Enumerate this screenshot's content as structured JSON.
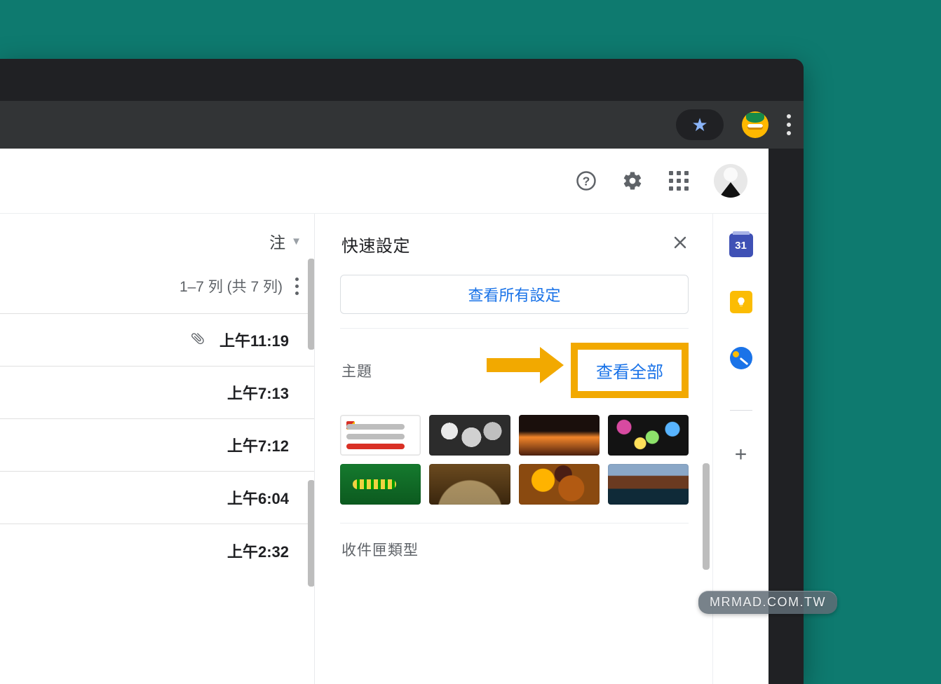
{
  "browser": {
    "star_tooltip": "Bookmark"
  },
  "header": {
    "help_name": "help-icon",
    "settings_name": "gear-icon",
    "apps_name": "apps-launcher-icon",
    "avatar_name": "account-avatar"
  },
  "list": {
    "note_label": "注",
    "count_text": "1–7 列 (共 7 列)",
    "rows": [
      {
        "attachment": true,
        "time": "上午11:19"
      },
      {
        "attachment": false,
        "time": "上午7:13"
      },
      {
        "attachment": false,
        "time": "上午7:12"
      },
      {
        "attachment": false,
        "time": "上午6:04"
      },
      {
        "attachment": false,
        "time": "上午2:32"
      }
    ]
  },
  "panel": {
    "title": "快速設定",
    "see_all_settings": "查看所有設定",
    "theme_section_title": "主題",
    "view_all_label": "查看全部",
    "inbox_type_section_title": "收件匣類型"
  },
  "rside": {
    "calendar_day": "31"
  },
  "watermark": "MRMAD.COM.TW",
  "colors": {
    "accent": "#1a73e8",
    "highlight": "#f2a900"
  }
}
